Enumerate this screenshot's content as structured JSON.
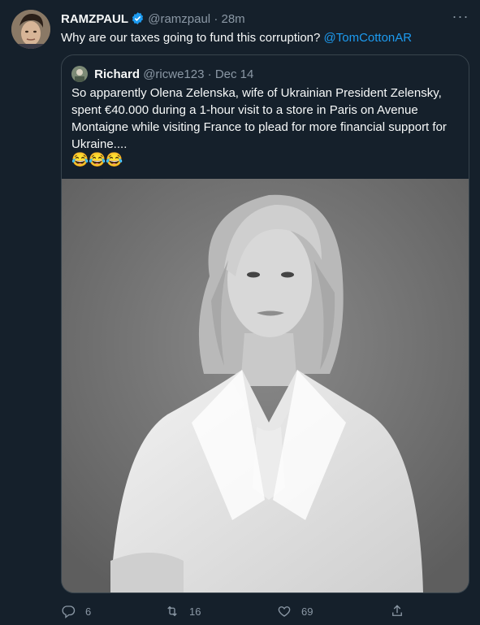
{
  "tweet": {
    "author_name": "RAMZPAUL",
    "author_handle": "@ramzpaul",
    "time": "28m",
    "text": "Why are our taxes going to fund this corruption?",
    "mention": "@TomCottonAR",
    "verified_color": "#1d9bf0"
  },
  "quote": {
    "author_name": "Richard",
    "author_handle": "@ricwe123",
    "date": "Dec 14",
    "text": "So apparently Olena Zelenska, wife of Ukrainian President Zelensky, spent €40.000 during a 1-hour visit to a store in Paris on Avenue Montaigne while visiting France to plead for more financial support for Ukraine....",
    "emoji": "😂😂😂"
  },
  "actions": {
    "replies": "6",
    "retweets": "16",
    "likes": "69"
  },
  "icons": [
    "verified-badge-icon",
    "more-icon",
    "reply-icon",
    "retweet-icon",
    "like-icon",
    "share-icon"
  ],
  "colors": {
    "background": "#15202b",
    "accent": "#1d9bf0",
    "muted": "#8b98a5",
    "border": "#38444d"
  }
}
